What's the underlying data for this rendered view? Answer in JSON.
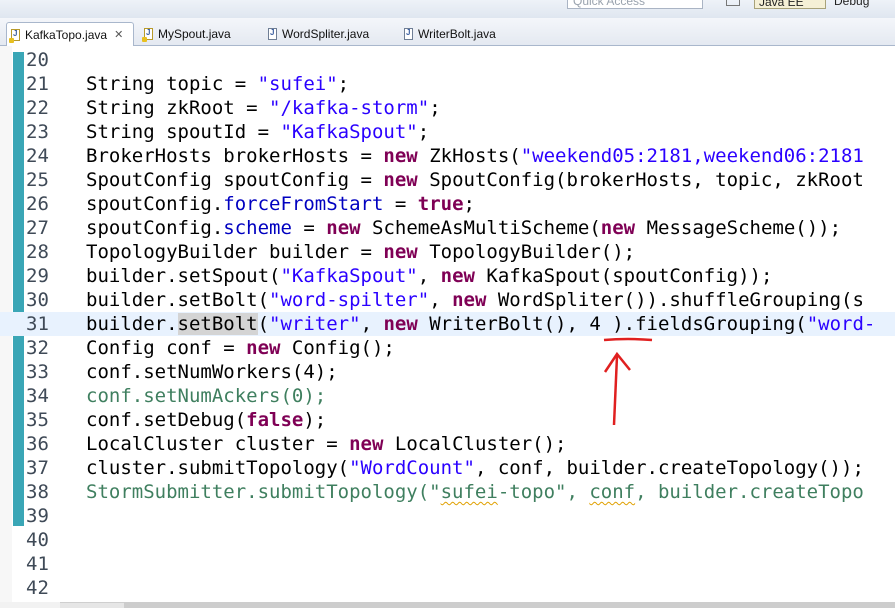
{
  "toolbar": {
    "quick_access_placeholder": "Quick Access",
    "perspectives": [
      "Java EE",
      "Debug"
    ]
  },
  "tabs": [
    {
      "label": "KafkaTopo.java",
      "active": true,
      "close": "✕"
    },
    {
      "label": "MySpout.java",
      "active": false
    },
    {
      "label": "WordSpliter.java",
      "active": false
    },
    {
      "label": "WriterBolt.java",
      "active": false
    }
  ],
  "editor": {
    "current_line": "31",
    "lines": [
      {
        "n": "20",
        "tokens": []
      },
      {
        "n": "21",
        "tokens": [
          {
            "t": "String topic = "
          },
          {
            "t": "\"sufei\"",
            "c": "s"
          },
          {
            "t": ";"
          }
        ]
      },
      {
        "n": "22",
        "tokens": [
          {
            "t": "String zkRoot = "
          },
          {
            "t": "\"/kafka-storm\"",
            "c": "s"
          },
          {
            "t": ";"
          }
        ]
      },
      {
        "n": "23",
        "tokens": [
          {
            "t": "String spoutId = "
          },
          {
            "t": "\"KafkaSpout\"",
            "c": "s"
          },
          {
            "t": ";"
          }
        ]
      },
      {
        "n": "24",
        "tokens": [
          {
            "t": "BrokerHosts brokerHosts = "
          },
          {
            "t": "new",
            "c": "k"
          },
          {
            "t": " ZkHosts("
          },
          {
            "t": "\"weekend05:2181,weekend06:2181",
            "c": "s"
          }
        ]
      },
      {
        "n": "25",
        "tokens": [
          {
            "t": "SpoutConfig spoutConfig = "
          },
          {
            "t": "new",
            "c": "k"
          },
          {
            "t": " SpoutConfig(brokerHosts, topic, zkRoot"
          }
        ]
      },
      {
        "n": "26",
        "tokens": [
          {
            "t": "spoutConfig."
          },
          {
            "t": "forceFromStart",
            "c": "f"
          },
          {
            "t": " = "
          },
          {
            "t": "true",
            "c": "k"
          },
          {
            "t": ";"
          }
        ]
      },
      {
        "n": "27",
        "tokens": [
          {
            "t": "spoutConfig."
          },
          {
            "t": "scheme",
            "c": "f"
          },
          {
            "t": " = "
          },
          {
            "t": "new",
            "c": "k"
          },
          {
            "t": " SchemeAsMultiScheme("
          },
          {
            "t": "new",
            "c": "k"
          },
          {
            "t": " MessageScheme());"
          }
        ]
      },
      {
        "n": "28",
        "tokens": [
          {
            "t": "TopologyBuilder builder = "
          },
          {
            "t": "new",
            "c": "k"
          },
          {
            "t": " TopologyBuilder();"
          }
        ]
      },
      {
        "n": "29",
        "tokens": [
          {
            "t": "builder.setSpout("
          },
          {
            "t": "\"KafkaSpout\"",
            "c": "s"
          },
          {
            "t": ", "
          },
          {
            "t": "new",
            "c": "k"
          },
          {
            "t": " KafkaSpout(spoutConfig));"
          }
        ]
      },
      {
        "n": "30",
        "tokens": [
          {
            "t": "builder.setBolt("
          },
          {
            "t": "\"word-spilter\"",
            "c": "s"
          },
          {
            "t": ", "
          },
          {
            "t": "new",
            "c": "k"
          },
          {
            "t": " WordSpliter()).shuffleGrouping(s"
          }
        ]
      },
      {
        "n": "31",
        "tokens": [
          {
            "t": "builder."
          },
          {
            "t": "setBolt",
            "c": "hl"
          },
          {
            "t": "("
          },
          {
            "t": "\"writer\"",
            "c": "s"
          },
          {
            "t": ", "
          },
          {
            "t": "new",
            "c": "k"
          },
          {
            "t": " WriterBolt(), 4 ).fieldsGrouping("
          },
          {
            "t": "\"word-",
            "c": "s"
          }
        ]
      },
      {
        "n": "32",
        "tokens": [
          {
            "t": "Config conf = "
          },
          {
            "t": "new",
            "c": "k"
          },
          {
            "t": " Config();"
          }
        ]
      },
      {
        "n": "33",
        "tokens": [
          {
            "t": "conf.setNumWorkers(4);"
          }
        ]
      },
      {
        "n": "34",
        "tokens": [
          {
            "t": "conf.setNumAckers(0);",
            "c": "c"
          }
        ]
      },
      {
        "n": "35",
        "tokens": [
          {
            "t": "conf.setDebug("
          },
          {
            "t": "false",
            "c": "k"
          },
          {
            "t": ");"
          }
        ]
      },
      {
        "n": "36",
        "tokens": [
          {
            "t": "LocalCluster cluster = "
          },
          {
            "t": "new",
            "c": "k"
          },
          {
            "t": " LocalCluster();"
          }
        ]
      },
      {
        "n": "37",
        "tokens": [
          {
            "t": "cluster.submitTopology("
          },
          {
            "t": "\"WordCount\"",
            "c": "s"
          },
          {
            "t": ", conf, builder.createTopology());"
          }
        ]
      },
      {
        "n": "38",
        "tokens": [
          {
            "t": "StormSubmitter.submitTopology(\"",
            "c": "c"
          },
          {
            "t": "sufei",
            "c": "c warn-ul"
          },
          {
            "t": "-topo\", ",
            "c": "c"
          },
          {
            "t": "conf",
            "c": "c warn-ul"
          },
          {
            "t": ", builder.createTopo",
            "c": "c"
          }
        ]
      },
      {
        "n": "39",
        "tokens": []
      },
      {
        "n": "40",
        "tokens": []
      },
      {
        "n": "41",
        "tokens": []
      },
      {
        "n": "42",
        "tokens": []
      }
    ]
  },
  "annotation": {
    "color": "#e02020"
  },
  "colors": {
    "string": "#2a00ff",
    "keyword": "#7f0055",
    "field": "#0000c0",
    "comment": "#3f7f5f",
    "current_line": "#e8f2fe"
  }
}
